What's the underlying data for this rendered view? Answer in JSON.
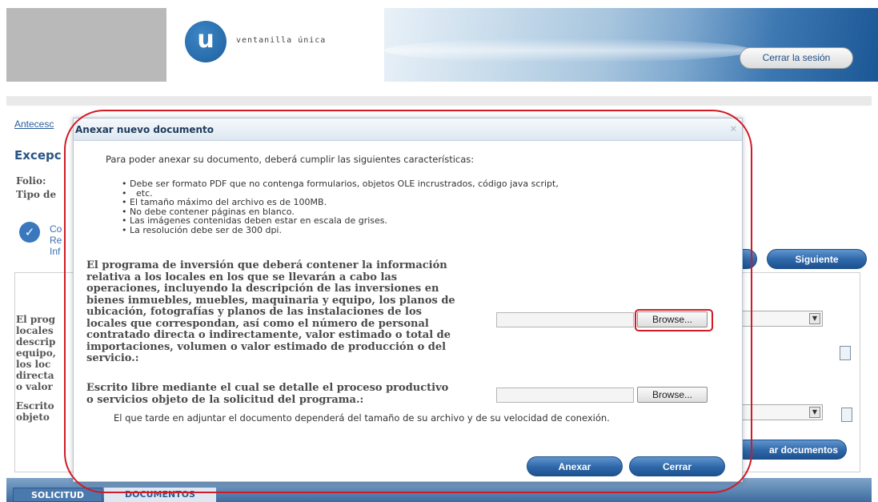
{
  "header": {
    "logo_letter": "u",
    "logo_text": "ventanilla única",
    "logout_label": "Cerrar la sesión"
  },
  "background": {
    "breadcrumb": "Antecesc",
    "title": "Excepc",
    "folio_label": "Folio:",
    "tipo_label": "Tipo de",
    "step_lines": [
      "Co",
      "Re",
      "Inf"
    ],
    "siguiente_label": "Siguiente",
    "adjuntar_label": "ar documentos",
    "row_fragments": [
      "El prog",
      "locales",
      "descrip",
      "equipo,",
      "los loc",
      "directa",
      "o valor",
      "Escrito",
      "objeto"
    ],
    "tabs": [
      "SOLICITUD",
      "DOCUMENTOS"
    ]
  },
  "modal": {
    "title": "Anexar nuevo documento",
    "close_icon": "×",
    "intro": "Para poder anexar su documento, deberá cumplir las siguientes características:",
    "requirements": [
      "Debe ser formato PDF que no contenga formularios, objetos OLE incrustrados, código java script,",
      "etc.",
      "El tamaño máximo del archivo es de 100MB.",
      "No debe contener páginas en blanco.",
      "Las imágenes contenidas deben estar en escala de grises.",
      "La resolución debe ser de 300 dpi."
    ],
    "field1_lines": [
      "El programa de inversión que deberá contener la información",
      "relativa a los locales en los que se llevarán a cabo las",
      "operaciones, incluyendo la descripción de las inversiones en",
      "bienes inmuebles, muebles, maquinaria y equipo, los planos de",
      "ubicación, fotografías y planos de las instalaciones de los",
      "locales que correspondan, así como el número de personal",
      "contratado directa o indirectamente, valor estimado o total de",
      "importaciones, volumen o valor estimado de producción o del",
      "servicio.:"
    ],
    "field2_lines": [
      "Escrito libre mediante el cual se detalle el proceso productivo",
      "o servicios objeto de la solicitud del programa.:"
    ],
    "browse_label": "Browse...",
    "note": "El que tarde en adjuntar el documento dependerá del tamaño de su archivo y de su velocidad de conexión.",
    "anexar_label": "Anexar",
    "cerrar_label": "Cerrar"
  }
}
